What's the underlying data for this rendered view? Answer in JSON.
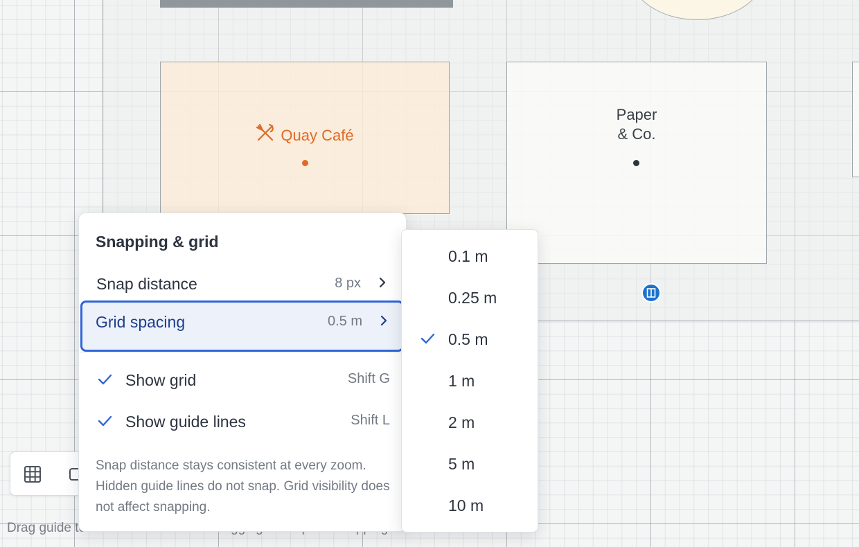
{
  "canvas": {
    "units": [
      {
        "name": "Quay Café",
        "icon": "fork-knife-icon",
        "color": "#e06a25"
      },
      {
        "line1": "Paper",
        "line2": "& Co.",
        "color": "#3a3f46"
      }
    ],
    "door_icon": "door-icon"
  },
  "toolbar": {
    "tools": [
      "grid-icon",
      "rectangle-icon"
    ]
  },
  "status": {
    "text": "Drag guide to move. Hold Alt while dragging to suspend snapping."
  },
  "menu": {
    "title": "Snapping & grid",
    "snap_distance": {
      "label": "Snap distance",
      "value": "8 px"
    },
    "grid_spacing": {
      "label": "Grid spacing",
      "value": "0.5 m"
    },
    "show_grid": {
      "label": "Show grid",
      "shortcut": "Shift G",
      "checked": true
    },
    "show_guides": {
      "label": "Show guide lines",
      "shortcut": "Shift L",
      "checked": true
    },
    "note": "Snap distance stays consistent at every zoom. Hidden guide lines do not snap. Grid visibility does not affect snapping."
  },
  "grid_options": {
    "items": [
      "0.1 m",
      "0.25 m",
      "0.5 m",
      "1 m",
      "2 m",
      "5 m",
      "10 m"
    ],
    "selected": "0.5 m"
  },
  "colors": {
    "accent": "#2f65d9",
    "cafe": "#e06a25",
    "door": "#1c73cc"
  }
}
